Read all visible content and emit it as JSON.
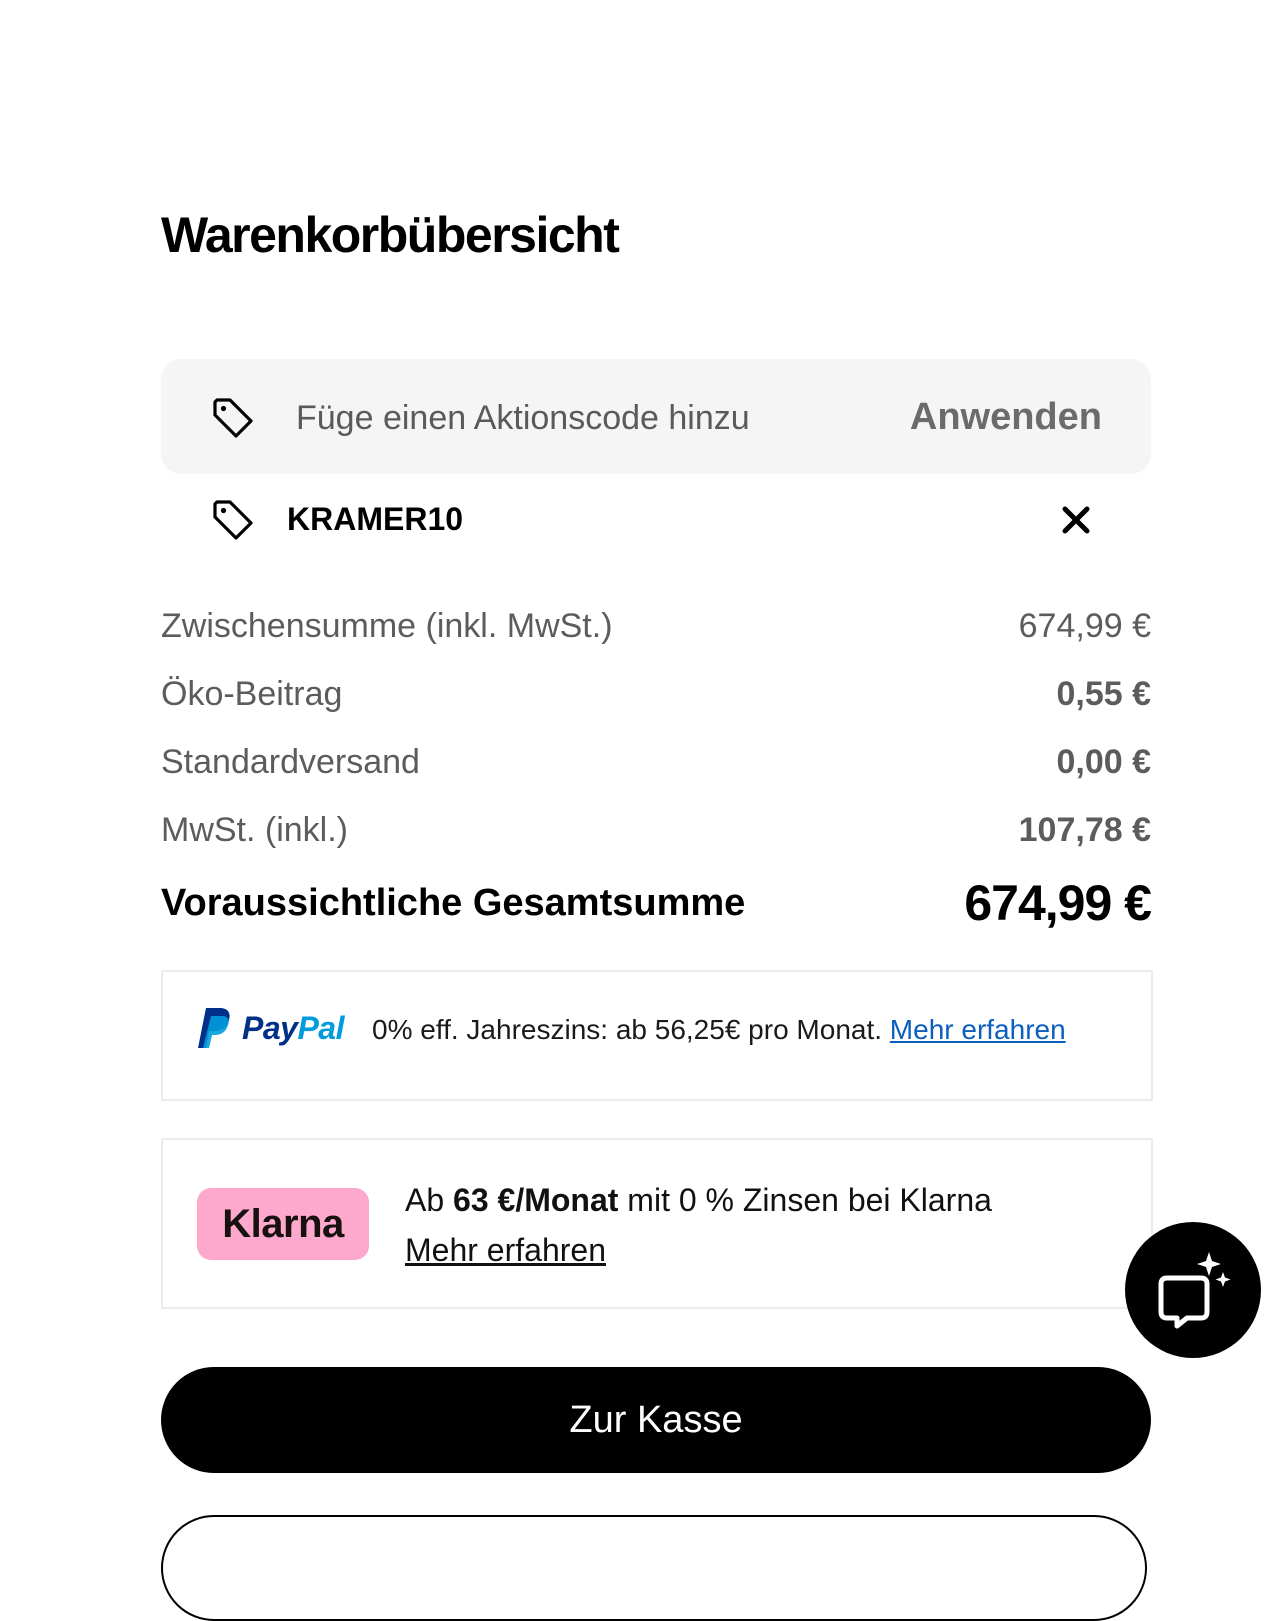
{
  "page": {
    "title": "Warenkorbübersicht"
  },
  "promo": {
    "placeholder": "Füge einen Aktionscode hinzu",
    "apply_label": "Anwenden",
    "applied_code": "KRAMER10",
    "tag_icon": "tag-icon",
    "remove_icon": "close-icon"
  },
  "summary": {
    "rows": [
      {
        "label": "Zwischensumme (inkl. MwSt.)",
        "value": "674,99 €",
        "bold_value": false
      },
      {
        "label": "Öko-Beitrag",
        "value": "0,55 €",
        "bold_value": true
      },
      {
        "label": "Standardversand",
        "value": "0,00 €",
        "bold_value": true
      },
      {
        "label": "MwSt. (inkl.)",
        "value": "107,78 €",
        "bold_value": true
      }
    ],
    "total_label": "Voraussichtliche Gesamtsumme",
    "total_value": "674,99 €"
  },
  "paypal": {
    "brand_pay": "Pay",
    "brand_pal": "Pal",
    "message": "0% eff. Jahreszins: ab 56,25€ pro Monat.",
    "link_label": "Mehr erfahren",
    "colors": {
      "pay": "#003087",
      "pal": "#009cde",
      "link": "#0a5fbf"
    }
  },
  "klarna": {
    "badge_label": "Klarna",
    "text_prefix": "Ab",
    "text_bold": "63 €/Monat",
    "text_suffix": "mit 0 % Zinsen bei Klarna",
    "link_label": "Mehr erfahren",
    "badge_color": "#ffa8cd"
  },
  "checkout": {
    "label": "Zur Kasse"
  },
  "chat": {
    "icon": "chat-sparkle-icon"
  }
}
